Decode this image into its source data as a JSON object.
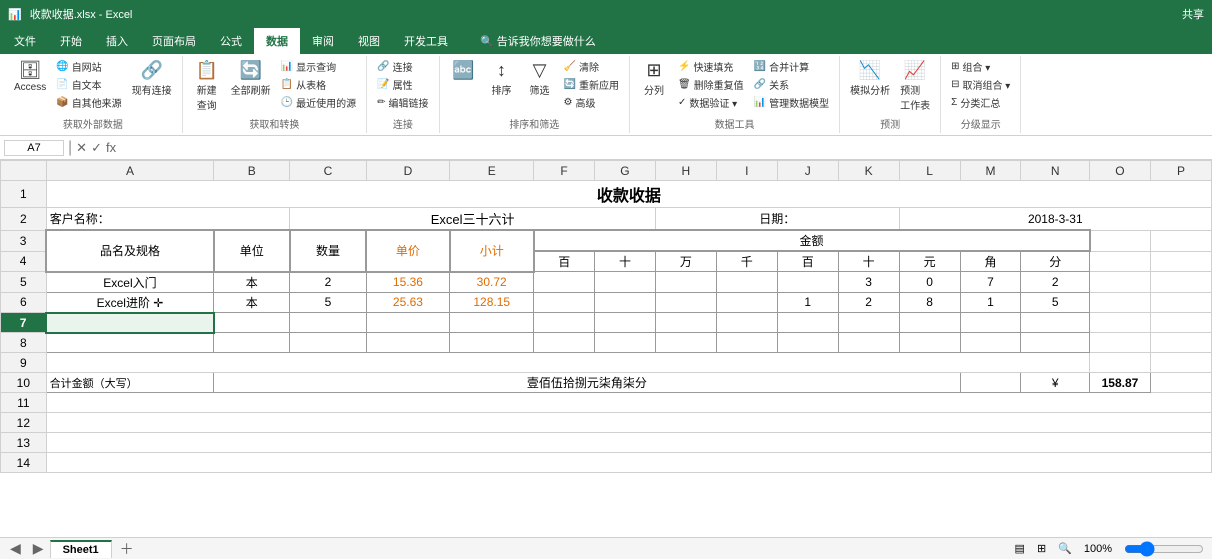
{
  "titleBar": {
    "title": "收款收据.xlsx - Excel",
    "shareLabel": "共享"
  },
  "ribbonTabs": [
    "文件",
    "开始",
    "插入",
    "页面布局",
    "公式",
    "数据",
    "审阅",
    "视图",
    "开发工具"
  ],
  "activeTab": "数据",
  "ribbonGroups": {
    "getExternal": {
      "label": "获取外部数据",
      "buttons": [
        "Access",
        "自网站",
        "自文本",
        "自其他来源",
        "现有连接"
      ]
    },
    "getTransform": {
      "label": "获取和转换",
      "buttons": [
        "新建查询",
        "全部刷新",
        "显示查询",
        "从表格",
        "最近使用的源"
      ]
    },
    "connections": {
      "label": "连接",
      "buttons": [
        "连接",
        "属性",
        "编辑链接"
      ]
    },
    "sortFilter": {
      "label": "排序和筛选",
      "buttons": [
        "排序",
        "筛选",
        "高级",
        "清除",
        "重新应用"
      ]
    },
    "dataTools": {
      "label": "数据工具",
      "buttons": [
        "分列",
        "快速填充",
        "删除重复值",
        "数据验证",
        "合并计算",
        "关系",
        "管理数据模型"
      ]
    },
    "forecast": {
      "label": "预测",
      "buttons": [
        "模拟分析",
        "预测工作表"
      ]
    },
    "outline": {
      "label": "分级显示",
      "buttons": [
        "组合",
        "取消组合",
        "分类汇总"
      ]
    }
  },
  "formulaBar": {
    "cellRef": "A7",
    "formula": ""
  },
  "spreadsheet": {
    "title": "收款收据",
    "customerLabel": "客户名称：",
    "customerName": "Excel三十六计",
    "dateLabel": "日期：",
    "dateValue": "2018-3-31",
    "amountHeader": "金额",
    "columns": {
      "headers": [
        "A",
        "B",
        "C",
        "D",
        "E",
        "F",
        "G",
        "H",
        "I",
        "J",
        "K",
        "L",
        "M",
        "N",
        "O",
        "P"
      ],
      "row3": [
        "品名及规格",
        "单位",
        "数量",
        "单价",
        "小计",
        "百",
        "十",
        "万",
        "千",
        "百",
        "十",
        "元",
        "角",
        "分",
        "",
        ""
      ],
      "row5": [
        "Excel入门",
        "本",
        "2",
        "15.36",
        "30.72",
        "",
        "",
        "",
        "",
        "",
        "3",
        "0",
        "7",
        "2",
        "",
        ""
      ],
      "row6": [
        "Excel进阶",
        "本",
        "5",
        "25.63",
        "128.15",
        "",
        "",
        "",
        "",
        "1",
        "2",
        "8",
        "1",
        "5",
        "",
        ""
      ],
      "row10": [
        "合计金额（大写）",
        "",
        "",
        "",
        "",
        "",
        "壹佰伍拾捌元柒角柒分",
        "",
        "",
        "",
        "",
        "",
        "",
        "",
        "¥",
        "158.87"
      ]
    },
    "selectedCell": "A7"
  },
  "statusBar": {
    "message": "",
    "sheet": "Sheet1",
    "zoom": "100%"
  }
}
